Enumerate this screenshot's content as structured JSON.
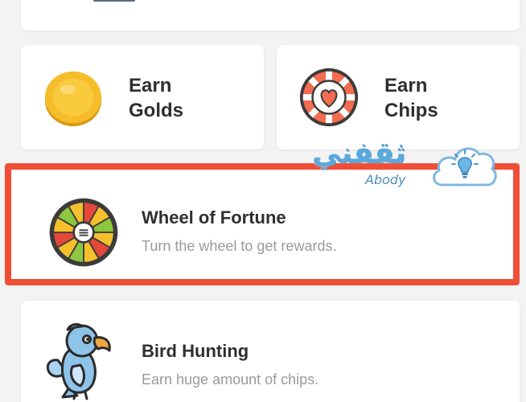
{
  "tiles": {
    "golds": {
      "line1": "Earn",
      "line2": "Golds"
    },
    "chips": {
      "line1": "Earn",
      "line2": "Chips"
    }
  },
  "rows": {
    "wheel": {
      "title": "Wheel of Fortune",
      "subtitle": "Turn the wheel to get rewards."
    },
    "bird": {
      "title": "Bird Hunting",
      "subtitle": "Earn huge amount of chips."
    }
  },
  "watermark": {
    "arabic": "ثقفني",
    "latin": "Abody"
  },
  "icons": {
    "golds": "gold-coin-icon",
    "chips": "heart-poker-chip-icon",
    "wheel": "fortune-wheel-icon",
    "bird": "parrot-icon",
    "watermark": "lightbulb-cloud-icon"
  },
  "colors": {
    "highlight_border": "#f04e37",
    "title_text": "#2f2f2f",
    "subtitle_text": "#9a9a9a",
    "watermark_blue": "#5aa9dd"
  }
}
